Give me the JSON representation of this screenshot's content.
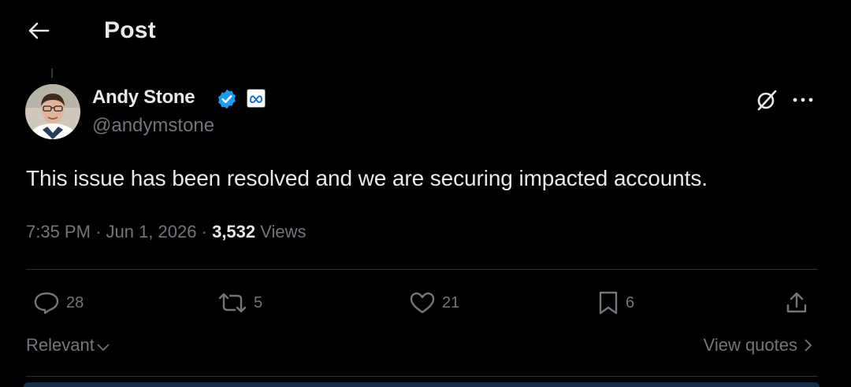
{
  "header": {
    "title": "Post",
    "back_icon": "arrow-left-icon"
  },
  "post": {
    "author": {
      "name": "Andy Stone",
      "handle": "@andymstone",
      "verified_color": "#1d9bf0",
      "affiliation_icon": "meta-logo-icon"
    },
    "text": "This issue has been resolved and we are securing impacted accounts.",
    "time": "7:35 PM",
    "date": "Jun 1, 2026",
    "views_count": "3,532",
    "views_label": "Views"
  },
  "actions": {
    "replies": "28",
    "reposts": "5",
    "likes": "21",
    "bookmarks": "6"
  },
  "replies_bar": {
    "sort_label": "Relevant",
    "view_quotes_label": "View quotes"
  },
  "colors": {
    "background": "#000000",
    "text": "#e7e9ea",
    "muted": "#71767b",
    "divider": "#2f3336"
  }
}
